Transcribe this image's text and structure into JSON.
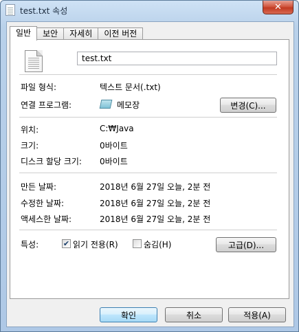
{
  "window": {
    "title": "test.txt 속성",
    "close_label": "✕"
  },
  "tabs": [
    {
      "label": "일반",
      "active": true
    },
    {
      "label": "보안",
      "active": false
    },
    {
      "label": "자세히",
      "active": false
    },
    {
      "label": "이전 버전",
      "active": false
    }
  ],
  "file": {
    "name": "test.txt"
  },
  "fields": {
    "file_type_label": "파일 형식:",
    "file_type_value": "텍스트 문서(.txt)",
    "opens_with_label": "연결 프로그램:",
    "opens_with_value": "메모장",
    "change_button": "변경(C)...",
    "location_label": "위치:",
    "location_value": "C:₩Java",
    "size_label": "크기:",
    "size_value": "0바이트",
    "size_on_disk_label": "디스크 할당 크기:",
    "size_on_disk_value": "0바이트",
    "created_label": "만든 날짜:",
    "created_value": "2018년 6월 27일 오늘, 2분 전",
    "modified_label": "수정한 날짜:",
    "modified_value": "2018년 6월 27일 오늘, 2분 전",
    "accessed_label": "액세스한 날짜:",
    "accessed_value": "2018년 6월 27일 오늘, 2분 전"
  },
  "attributes": {
    "label": "특성:",
    "read_only_label": "읽기 전용(R)",
    "read_only_checked": true,
    "hidden_label": "숨김(H)",
    "hidden_checked": false,
    "advanced_button": "고급(D)..."
  },
  "footer": {
    "ok_button": "확인",
    "cancel_button": "취소",
    "apply_button": "적용(A)"
  }
}
